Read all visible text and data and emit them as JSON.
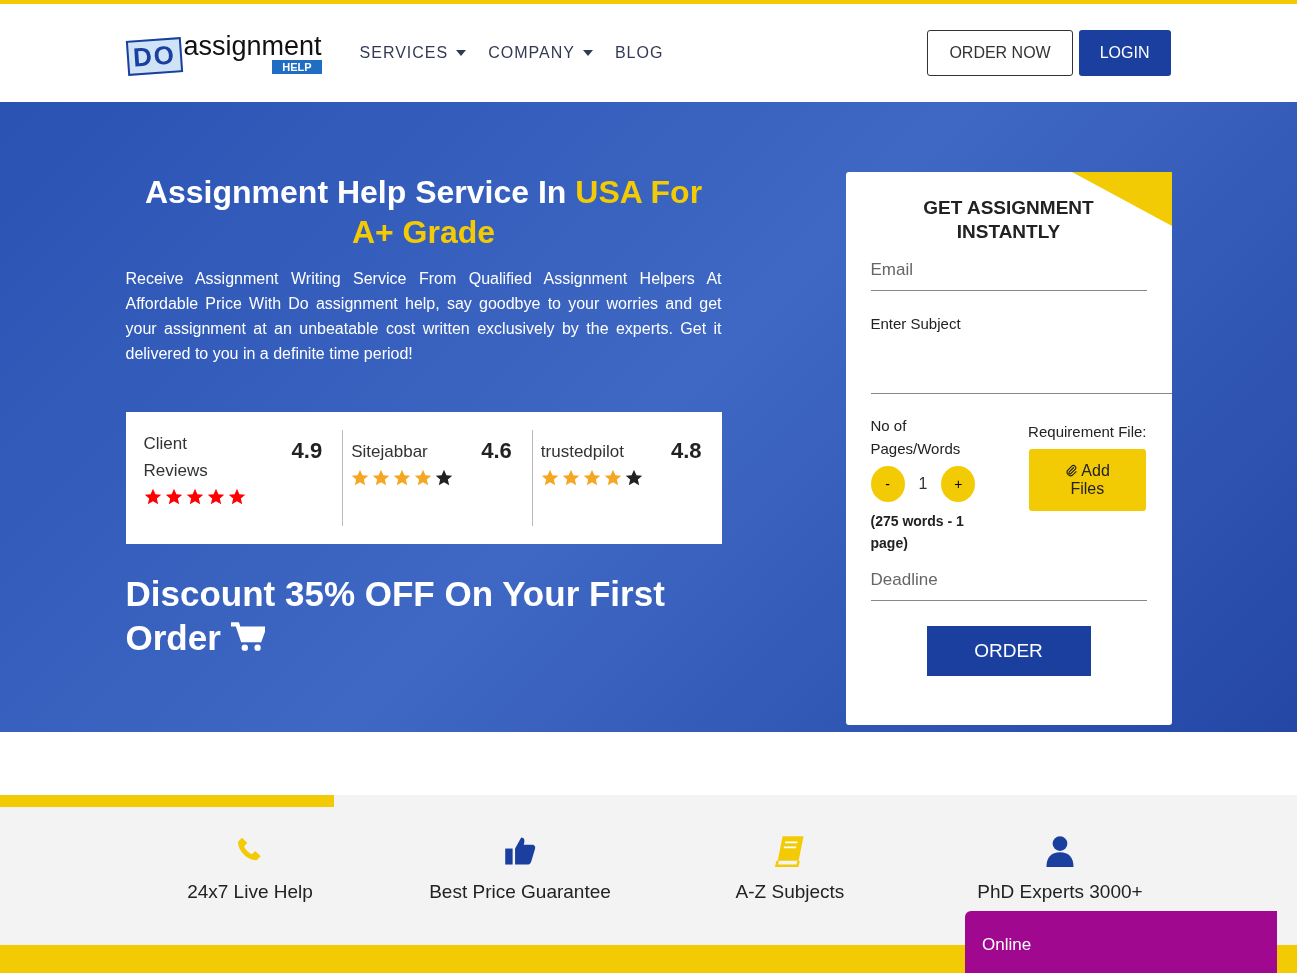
{
  "header": {
    "logo": {
      "letters": "DO",
      "word": "assignment",
      "tag": "HELP"
    },
    "nav": [
      {
        "label": "SERVICES",
        "dropdown": true
      },
      {
        "label": "COMPANY",
        "dropdown": true
      },
      {
        "label": "BLOG",
        "dropdown": false
      }
    ],
    "buttons": [
      {
        "label": "ORDER NOW",
        "kind": "outline"
      },
      {
        "label": "LOGIN",
        "kind": "solid"
      }
    ]
  },
  "hero": {
    "heading": [
      {
        "text": "Assignment Help Service In ",
        "highlight": false
      },
      {
        "text": "USA For A+ Grade",
        "highlight": true
      }
    ],
    "intro": "Receive Assignment Writing Service From Qualified Assignment Helpers At Affordable Price With Do assignment help, say goodbye to your worries and get your assignment at an unbeatable cost written exclusively by the experts. Get it delivered to you in a definite time period!",
    "ratings": [
      {
        "source": "Client Reviews",
        "score": "4.9",
        "stars": 5,
        "color": "#ff0000"
      },
      {
        "source": "Sitejabbar",
        "score": "4.6",
        "stars": 4,
        "color": "#f5a623"
      },
      {
        "source": "trustedpilot",
        "score": "4.8",
        "stars": 4,
        "color": "#f5a623"
      }
    ],
    "discount": "Discount 35% OFF On Your First Order"
  },
  "form": {
    "title": "GET ASSIGNMENT INSTANTLY",
    "email_placeholder": "Email",
    "subject_placeholder": "Enter Subject",
    "pages_label": "No of Pages/Words",
    "minus": "-",
    "pages_value": "1",
    "plus": "+",
    "pages_note": "(275 words - 1 page)",
    "file_label": "Requirement File:",
    "file_button": "Add Files",
    "deadline_placeholder": "Deadline",
    "submit": "ORDER"
  },
  "features": [
    {
      "label": "24x7 Live Help"
    },
    {
      "label": "Best Price Guarantee"
    },
    {
      "label": "A-Z Subjects"
    },
    {
      "label": "PhD Experts 3000+"
    }
  ],
  "chat": {
    "label": "Online"
  }
}
